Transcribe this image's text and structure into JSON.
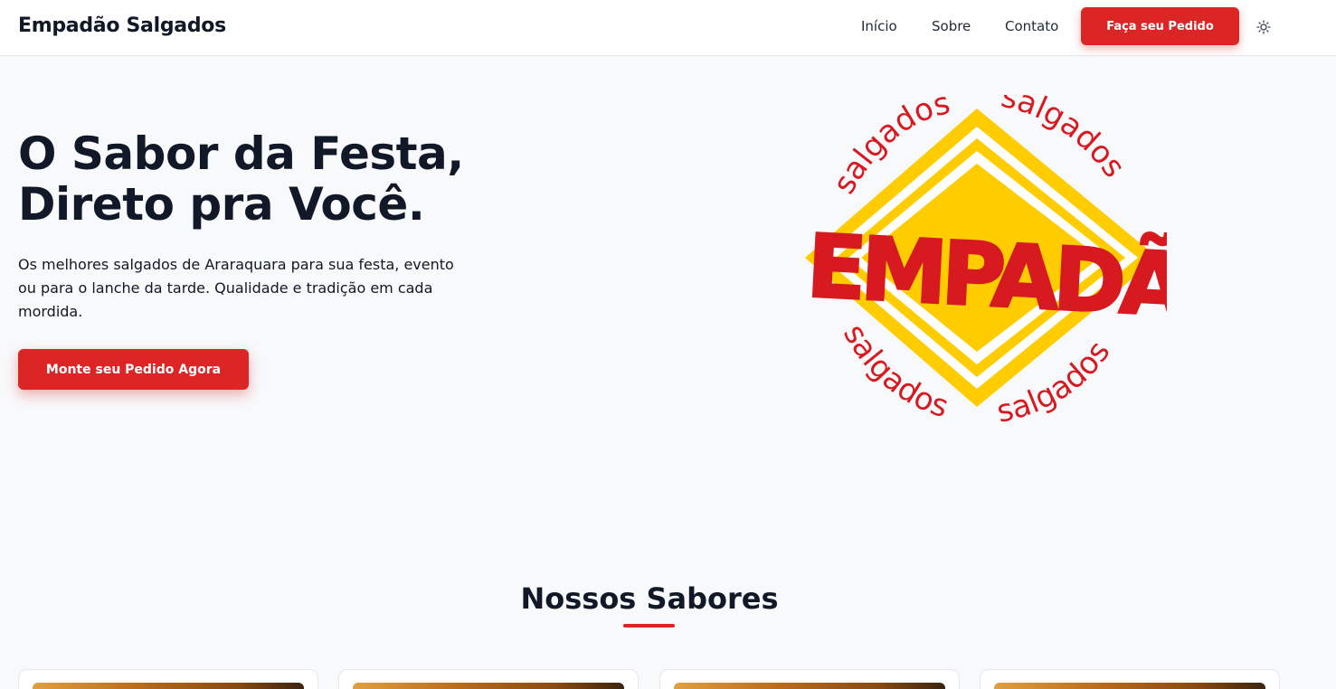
{
  "header": {
    "brand": "Empadão Salgados",
    "nav": [
      {
        "label": "Início"
      },
      {
        "label": "Sobre"
      },
      {
        "label": "Contato"
      }
    ],
    "cta_label": "Faça seu Pedido",
    "theme_icon": "sun-icon"
  },
  "hero": {
    "title_line1": "O Sabor da Festa,",
    "title_line2": "Direto pra Você.",
    "description": "Os melhores salgados de Araraquara para sua festa, evento ou para o lanche da tarde. Qualidade e tradição em cada mordida.",
    "cta_label": "Monte seu Pedido Agora",
    "logo": {
      "word": "EMPADÃO",
      "ring_text": "salgados",
      "colors": {
        "red": "#d71920",
        "yellow": "#ffcc00"
      }
    }
  },
  "sabores": {
    "title": "Nossos Sabores",
    "cards": [
      {
        "image": "salgado-photo"
      },
      {
        "image": "salgado-photo"
      },
      {
        "image": "salgado-photo"
      },
      {
        "image": "salgado-photo"
      }
    ]
  },
  "colors": {
    "accent": "#dc2626",
    "text": "#111827",
    "background": "#f8f9fb"
  }
}
